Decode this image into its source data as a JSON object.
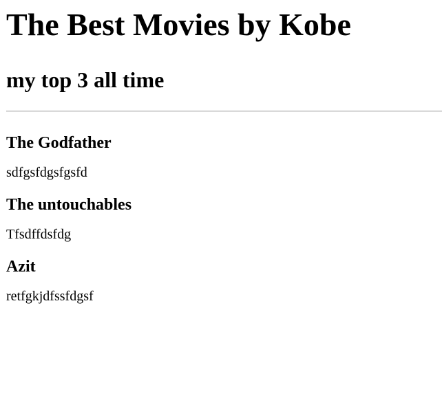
{
  "header": {
    "title": "The Best Movies by Kobe",
    "subtitle": "my top 3 all time"
  },
  "movies": [
    {
      "title": "The Godfather",
      "description": "sdfgsfdgsfgsfd"
    },
    {
      "title": "The untouchables",
      "description": "Tfsdffdsfdg"
    },
    {
      "title": "Azit",
      "description": "retfgkjdfssfdgsf"
    }
  ]
}
